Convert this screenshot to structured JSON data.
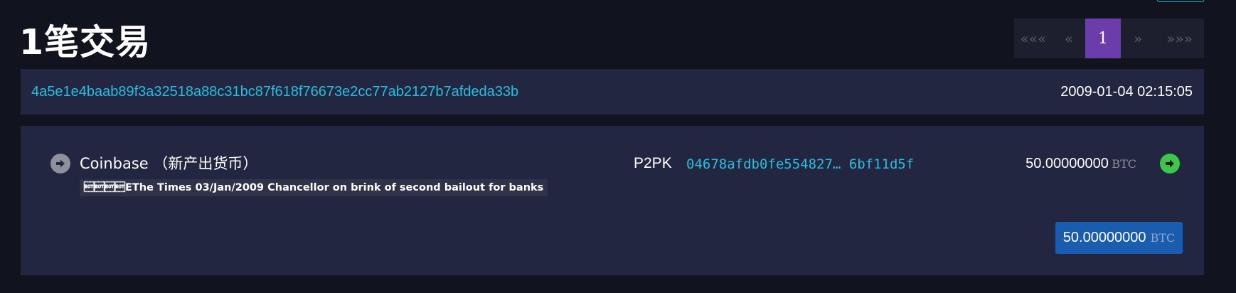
{
  "page": {
    "title": "1笔交易"
  },
  "pagination": {
    "first": "«««",
    "prev": "«",
    "current": "1",
    "next": "»",
    "last": "»»»"
  },
  "transaction": {
    "hash": "4a5e1e4baab89f3a32518a88c31bc87f618f76673e2cc77ab2127b7afdeda33b",
    "timestamp": "2009-01-04 02:15:05",
    "input": {
      "label": "Coinbase （新产出货币）",
      "icon": "arrow-right-circle-icon",
      "coinbase_message": "\u0004\u0004\u0004\u0004EThe Times 03/Jan/2009 Chancellor on brink of second bailout for banks"
    },
    "output": {
      "script_type": "P2PK",
      "address": "04678afdb0fe554827… 6bf11d5f",
      "amount": "50.00000000",
      "unit": "BTC",
      "icon": "arrow-right-circle-icon"
    },
    "total": {
      "amount": "50.00000000",
      "unit": "BTC"
    }
  },
  "colors": {
    "background": "#11131e",
    "panel": "#232640",
    "link": "#27bfe0",
    "pager_active": "#6a3dab",
    "output_arrow": "#3ec64b",
    "total_badge": "#1a5cad"
  }
}
